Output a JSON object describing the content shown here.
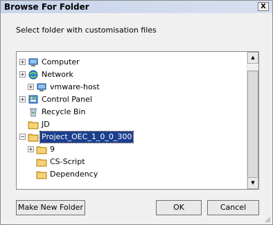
{
  "dialog": {
    "title": "Browse For Folder",
    "close_symbol": "X",
    "instruction": "Select folder with customisation files"
  },
  "tree": {
    "items": [
      {
        "label": "Computer",
        "icon": "computer-icon",
        "expander": "+"
      },
      {
        "label": "Network",
        "icon": "network-icon",
        "expander": "+"
      },
      {
        "label": "vmware-host",
        "icon": "computer-icon",
        "expander": "+"
      },
      {
        "label": "Control Panel",
        "icon": "control-panel-icon",
        "expander": "+"
      },
      {
        "label": "Recycle Bin",
        "icon": "recycle-bin-icon",
        "expander": ""
      },
      {
        "label": "JD",
        "icon": "folder-icon",
        "expander": ""
      },
      {
        "label": "Project_OEC_1_0_0_300",
        "icon": "folder-icon",
        "expander": "−",
        "selected": true
      },
      {
        "label": "9",
        "icon": "folder-icon",
        "expander": "+"
      },
      {
        "label": "CS-Script",
        "icon": "folder-icon",
        "expander": ""
      },
      {
        "label": "Dependency",
        "icon": "folder-icon",
        "expander": ""
      }
    ],
    "scroll": {
      "up_symbol": "▲",
      "down_symbol": "▼"
    }
  },
  "buttons": {
    "make_new_folder": "Make New Folder",
    "ok": "OK",
    "cancel": "Cancel"
  },
  "colors": {
    "selection": "#1b3f8f",
    "folder": "#e8b640"
  }
}
